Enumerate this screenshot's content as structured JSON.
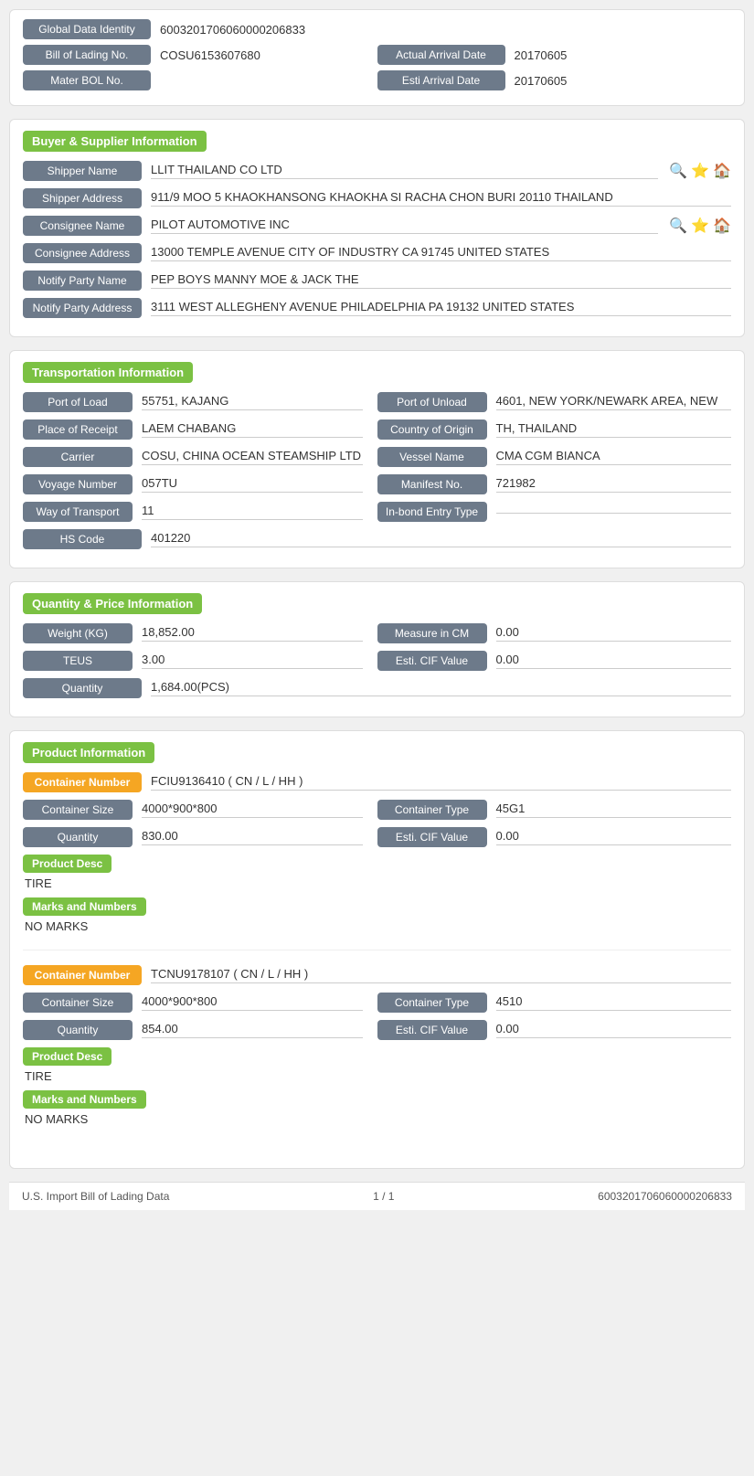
{
  "header": {
    "global_data_identity_label": "Global Data Identity",
    "global_data_identity_value": "6003201706060000206833",
    "bill_of_lading_label": "Bill of Lading No.",
    "bill_of_lading_value": "COSU6153607680",
    "actual_arrival_date_label": "Actual Arrival Date",
    "actual_arrival_date_value": "20170605",
    "mater_bol_label": "Mater BOL No.",
    "mater_bol_value": "",
    "esti_arrival_date_label": "Esti Arrival Date",
    "esti_arrival_date_value": "20170605"
  },
  "buyer_supplier": {
    "section_title": "Buyer & Supplier Information",
    "shipper_name_label": "Shipper Name",
    "shipper_name_value": "LLIT THAILAND CO LTD",
    "shipper_address_label": "Shipper Address",
    "shipper_address_value": "911/9 MOO 5 KHAOKHANSONG KHAOKHA SI RACHA CHON BURI 20110 THAILAND",
    "consignee_name_label": "Consignee Name",
    "consignee_name_value": "PILOT AUTOMOTIVE INC",
    "consignee_address_label": "Consignee Address",
    "consignee_address_value": "13000 TEMPLE AVENUE CITY OF INDUSTRY CA 91745 UNITED STATES",
    "notify_party_name_label": "Notify Party Name",
    "notify_party_name_value": "PEP BOYS MANNY MOE & JACK THE",
    "notify_party_address_label": "Notify Party Address",
    "notify_party_address_value": "3111 WEST ALLEGHENY AVENUE PHILADELPHIA PA 19132 UNITED STATES"
  },
  "transportation": {
    "section_title": "Transportation Information",
    "port_of_load_label": "Port of Load",
    "port_of_load_value": "55751, KAJANG",
    "port_of_unload_label": "Port of Unload",
    "port_of_unload_value": "4601, NEW YORK/NEWARK AREA, NEW",
    "place_of_receipt_label": "Place of Receipt",
    "place_of_receipt_value": "LAEM CHABANG",
    "country_of_origin_label": "Country of Origin",
    "country_of_origin_value": "TH, THAILAND",
    "carrier_label": "Carrier",
    "carrier_value": "COSU, CHINA OCEAN STEAMSHIP LTD",
    "vessel_name_label": "Vessel Name",
    "vessel_name_value": "CMA CGM BIANCA",
    "voyage_number_label": "Voyage Number",
    "voyage_number_value": "057TU",
    "manifest_no_label": "Manifest No.",
    "manifest_no_value": "721982",
    "way_of_transport_label": "Way of Transport",
    "way_of_transport_value": "11",
    "in_bond_entry_type_label": "In-bond Entry Type",
    "in_bond_entry_type_value": "",
    "hs_code_label": "HS Code",
    "hs_code_value": "401220"
  },
  "quantity_price": {
    "section_title": "Quantity & Price Information",
    "weight_kg_label": "Weight (KG)",
    "weight_kg_value": "18,852.00",
    "measure_in_cm_label": "Measure in CM",
    "measure_in_cm_value": "0.00",
    "teus_label": "TEUS",
    "teus_value": "3.00",
    "esti_cif_value_label": "Esti. CIF Value",
    "esti_cif_value": "0.00",
    "quantity_label": "Quantity",
    "quantity_value": "1,684.00(PCS)"
  },
  "product_information": {
    "section_title": "Product Information",
    "containers": [
      {
        "container_number_label": "Container Number",
        "container_number_value": "FCIU9136410 ( CN / L / HH )",
        "container_size_label": "Container Size",
        "container_size_value": "4000*900*800",
        "container_type_label": "Container Type",
        "container_type_value": "45G1",
        "quantity_label": "Quantity",
        "quantity_value": "830.00",
        "esti_cif_label": "Esti. CIF Value",
        "esti_cif_value": "0.00",
        "product_desc_label": "Product Desc",
        "product_desc_value": "TIRE",
        "marks_label": "Marks and Numbers",
        "marks_value": "NO MARKS"
      },
      {
        "container_number_label": "Container Number",
        "container_number_value": "TCNU9178107 ( CN / L / HH )",
        "container_size_label": "Container Size",
        "container_size_value": "4000*900*800",
        "container_type_label": "Container Type",
        "container_type_value": "4510",
        "quantity_label": "Quantity",
        "quantity_value": "854.00",
        "esti_cif_label": "Esti. CIF Value",
        "esti_cif_value": "0.00",
        "product_desc_label": "Product Desc",
        "product_desc_value": "TIRE",
        "marks_label": "Marks and Numbers",
        "marks_value": "NO MARKS"
      }
    ]
  },
  "footer": {
    "left_text": "U.S. Import Bill of Lading Data",
    "center_text": "1 / 1",
    "right_text": "6003201706060000206833"
  },
  "icons": {
    "search": "🔍",
    "star": "⭐",
    "home": "🏠"
  }
}
